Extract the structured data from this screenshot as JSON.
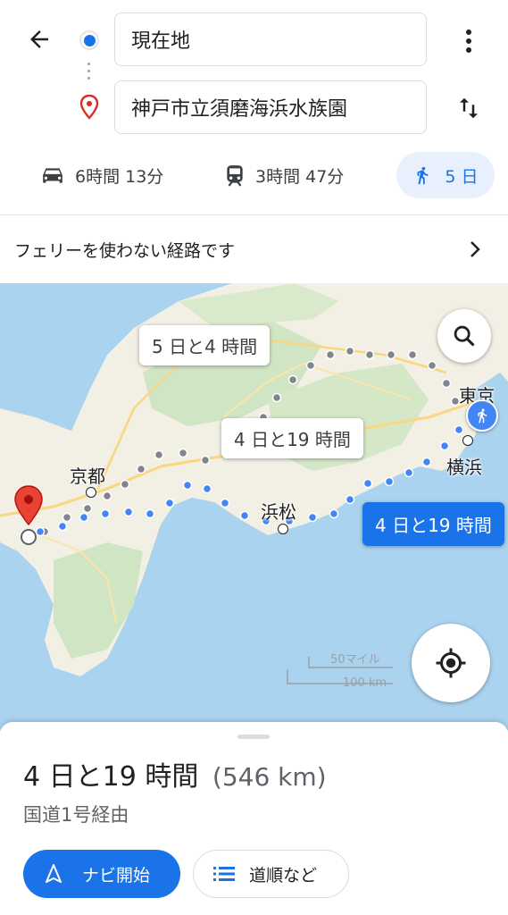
{
  "search": {
    "origin": "現在地",
    "destination": "神戸市立須磨海浜水族園"
  },
  "modes": [
    {
      "icon": "car-icon",
      "label": "6時間 13分"
    },
    {
      "icon": "train-icon",
      "label": "3時間 47分"
    },
    {
      "icon": "walk-icon",
      "label": "5 日",
      "selected": true
    }
  ],
  "notice": {
    "text": "フェリーを使わない経路です"
  },
  "map": {
    "route_bubbles": [
      "5 日と4 時間",
      "4 日と19 時間"
    ],
    "selected_bubble": "4 日と19 時間",
    "cities": [
      "東京",
      "京都",
      "横浜",
      "浜松"
    ],
    "scale_bar": {
      "miles": "50マイル",
      "km": "100 km"
    }
  },
  "route": {
    "duration": "4 日と19 時間",
    "distance": "(546 km)",
    "via": "国道1号経由",
    "start_label": "ナビ開始",
    "steps_label": "道順など"
  },
  "colors": {
    "accent": "#1a73e8",
    "marker": "#d93025",
    "water": "#aad3f0",
    "land": "#f2efe4"
  }
}
